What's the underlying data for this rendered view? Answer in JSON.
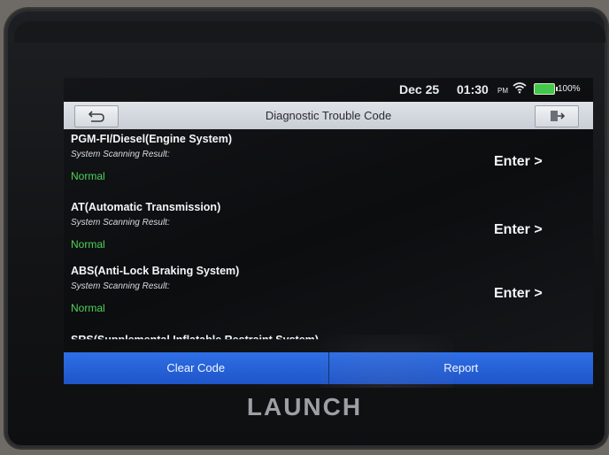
{
  "status": {
    "date": "Dec 25",
    "time": "01:30",
    "ampm": "PM",
    "battery": "100%",
    "battery_color": "#43c84a"
  },
  "titlebar": {
    "title": "Diagnostic Trouble Code",
    "back_icon": "back-arrow-icon",
    "exit_icon": "exit-door-icon"
  },
  "systems": [
    {
      "name": "PGM-FI/Diesel(Engine System)",
      "label": "System Scanning Result:",
      "result": "Normal",
      "action": "Enter >"
    },
    {
      "name": "AT(Automatic Transmission)",
      "label": "System Scanning Result:",
      "result": "Normal",
      "action": "Enter >"
    },
    {
      "name": "ABS(Anti-Lock Braking System)",
      "label": "System Scanning Result:",
      "result": "Normal",
      "action": "Enter >"
    },
    {
      "name": "SRS(Supplemental Inflatable Restraint System)"
    }
  ],
  "buttons": {
    "clear": "Clear Code",
    "report": "Report"
  },
  "brand": "LAUNCH",
  "colors": {
    "accent": "#2f6fe6",
    "ok": "#4ed35a"
  }
}
